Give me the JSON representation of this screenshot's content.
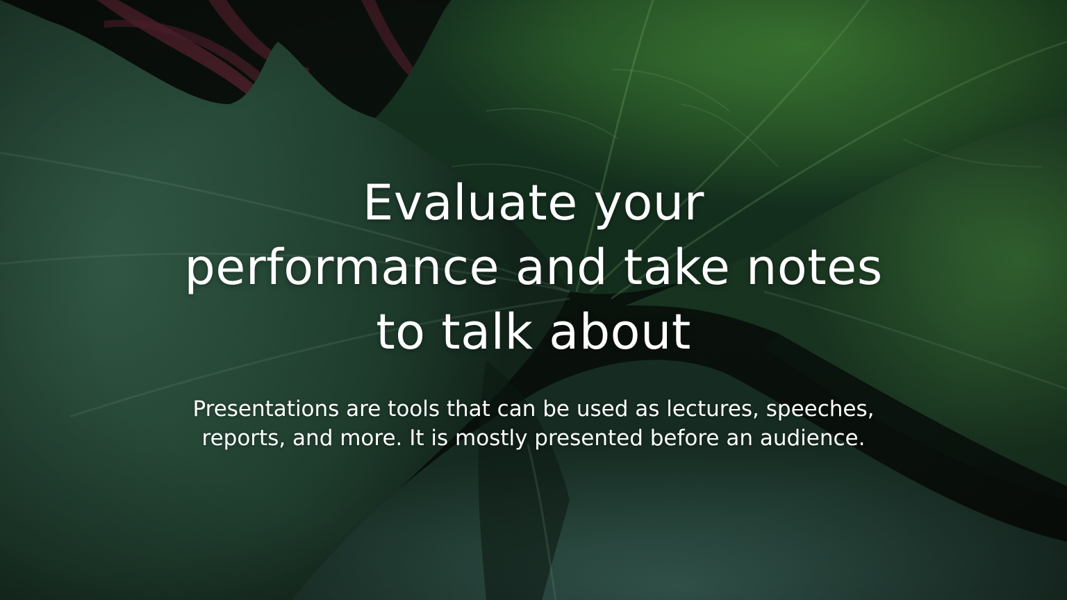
{
  "slide": {
    "title": "Evaluate your\nperformance and take notes\nto talk about",
    "body": "Presentations are tools that can be used as lectures, speeches,\nreports, and more. It is mostly presented before an audience."
  },
  "colors": {
    "text": "#ffffff",
    "leaf_bright": "#2f6b2c",
    "leaf_dark": "#1c3a27",
    "leaf_shadow": "#0d1a12",
    "stem_accent": "#5a2432"
  }
}
